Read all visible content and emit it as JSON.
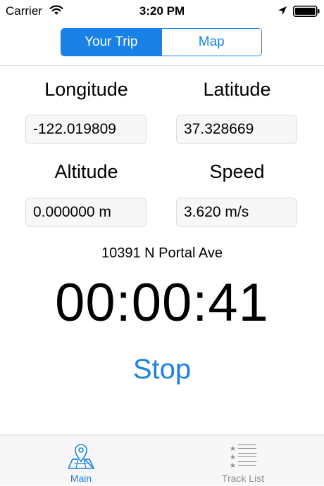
{
  "status_bar": {
    "carrier": "Carrier",
    "time": "3:20 PM",
    "icons": [
      "wifi-icon",
      "location-arrow-icon",
      "battery-icon"
    ]
  },
  "segmented": {
    "items": [
      {
        "label": "Your Trip",
        "selected": true
      },
      {
        "label": "Map",
        "selected": false
      }
    ]
  },
  "location": {
    "longitude_label": "Longitude",
    "longitude_value": "-122.019809",
    "latitude_label": "Latitude",
    "latitude_value": "37.328669",
    "altitude_label": "Altitude",
    "altitude_value": "0.000000 m",
    "speed_label": "Speed",
    "speed_value": "3.620 m/s",
    "address": "10391 N Portal Ave"
  },
  "timer": "00:00:41",
  "action": {
    "stop_label": "Stop"
  },
  "tab_bar": {
    "items": [
      {
        "label": "Main",
        "icon": "map-pin-icon",
        "selected": true
      },
      {
        "label": "Track List",
        "icon": "star-list-icon",
        "selected": false
      }
    ]
  },
  "colors": {
    "accent": "#1a82e6",
    "inactive": "#8e8e93",
    "field_bg": "#f7f7f7"
  }
}
